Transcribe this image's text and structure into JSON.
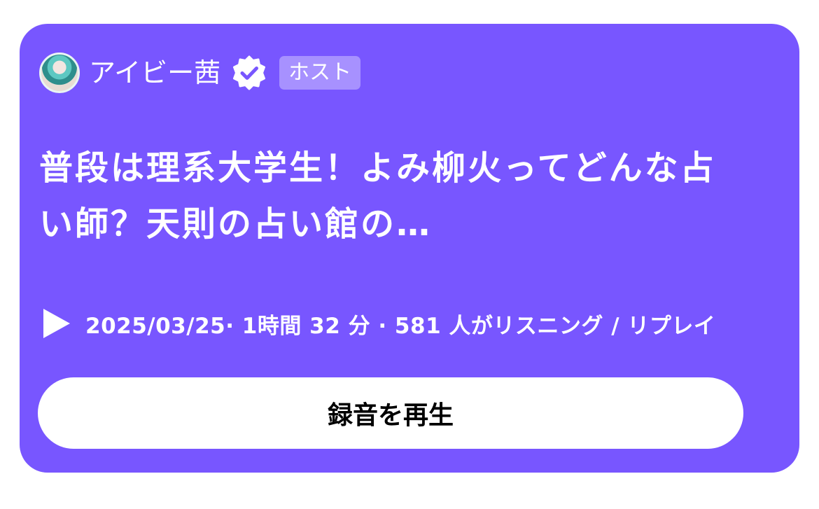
{
  "card": {
    "background_color": "#7856ff",
    "host": {
      "name": "アイビー茜",
      "avatar_icon": "user-avatar",
      "verified_icon": "verified-badge-icon",
      "badge_label": "ホスト"
    },
    "title": "普段は理系大学生！よみ柳火ってどんな占い師？天則の占い館の…",
    "meta": {
      "play_icon": "play-icon",
      "text": "2025/03/25· 1時間 32 分 · 581 人がリスニング / リプレイ"
    },
    "play_button_label": "録音を再生"
  }
}
